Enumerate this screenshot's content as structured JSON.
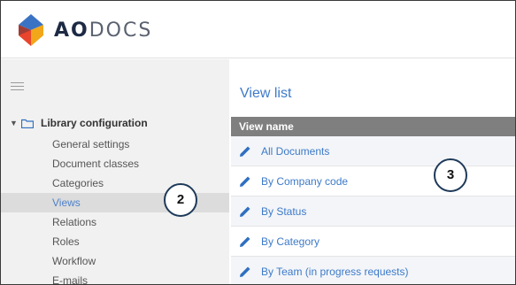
{
  "brand": {
    "ao": "AO",
    "docs": "DOCS"
  },
  "sidebar": {
    "root_label": "Library configuration",
    "items": [
      {
        "label": "General settings"
      },
      {
        "label": "Document classes"
      },
      {
        "label": "Categories"
      },
      {
        "label": "Views",
        "active": true
      },
      {
        "label": "Relations"
      },
      {
        "label": "Roles"
      },
      {
        "label": "Workflow"
      },
      {
        "label": "E-mails"
      }
    ]
  },
  "main": {
    "title": "View list",
    "column_header": "View name",
    "rows": [
      {
        "label": "All Documents"
      },
      {
        "label": "By Company code"
      },
      {
        "label": "By Status"
      },
      {
        "label": "By Category"
      },
      {
        "label": "By Team (in progress requests)"
      }
    ]
  },
  "callouts": {
    "sidebar": "2",
    "list": "3"
  },
  "colors": {
    "accent": "#3d7ac9",
    "header_bg": "#7f7f7f",
    "sidebar_bg": "#f1f1f1",
    "callout_border": "#1e3a5a"
  }
}
